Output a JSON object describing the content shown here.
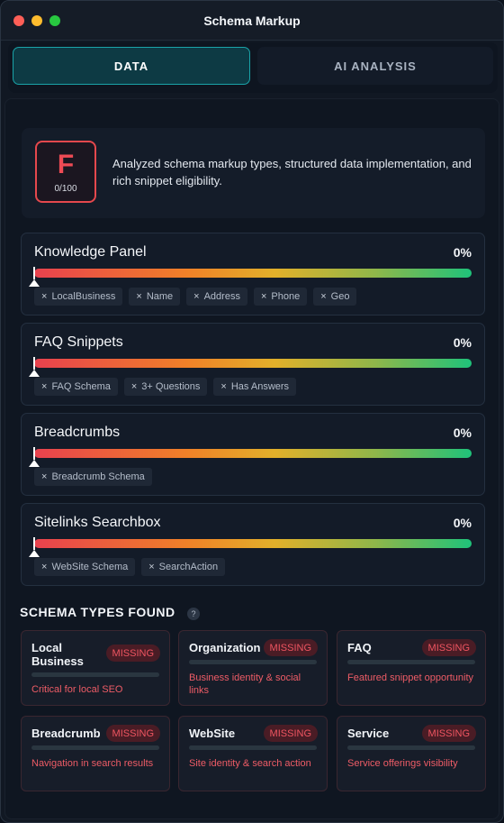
{
  "window": {
    "title": "Schema Markup",
    "lights": [
      "#fe5f57",
      "#febc2e",
      "#28c840"
    ]
  },
  "tabs": [
    {
      "label": "DATA",
      "active": true
    },
    {
      "label": "AI ANALYSIS",
      "active": false
    }
  ],
  "score": {
    "grade": "F",
    "value": "0/100",
    "description": "Analyzed schema markup types, structured data implementation, and rich snippet eligibility."
  },
  "features": [
    {
      "name": "Knowledge Panel",
      "percent": "0%",
      "progress": 0,
      "checks": [
        "LocalBusiness",
        "Name",
        "Address",
        "Phone",
        "Geo"
      ]
    },
    {
      "name": "FAQ Snippets",
      "percent": "0%",
      "progress": 0,
      "checks": [
        "FAQ Schema",
        "3+ Questions",
        "Has Answers"
      ]
    },
    {
      "name": "Breadcrumbs",
      "percent": "0%",
      "progress": 0,
      "checks": [
        "Breadcrumb Schema"
      ]
    },
    {
      "name": "Sitelinks Searchbox",
      "percent": "0%",
      "progress": 0,
      "checks": [
        "WebSite Schema",
        "SearchAction"
      ]
    }
  ],
  "check_icon": "x-mark",
  "schema_types": {
    "title": "SCHEMA TYPES FOUND",
    "help": "?",
    "items": [
      {
        "name": "Local\nBusiness",
        "status": "MISSING",
        "description": "Critical for local SEO"
      },
      {
        "name": "Organization",
        "status": "MISSING",
        "description": "Business identity & social links"
      },
      {
        "name": "FAQ",
        "status": "MISSING",
        "description": "Featured snippet opportunity"
      },
      {
        "name": "Breadcrumb",
        "status": "MISSING",
        "description": "Navigation in search results"
      },
      {
        "name": "WebSite",
        "status": "MISSING",
        "description": "Site identity & search action"
      },
      {
        "name": "Service",
        "status": "MISSING",
        "description": "Service offerings visibility"
      }
    ]
  },
  "colors": {
    "accent": "#1aa3a8",
    "fail": "#e5484d",
    "missing_text": "#ef5561"
  }
}
